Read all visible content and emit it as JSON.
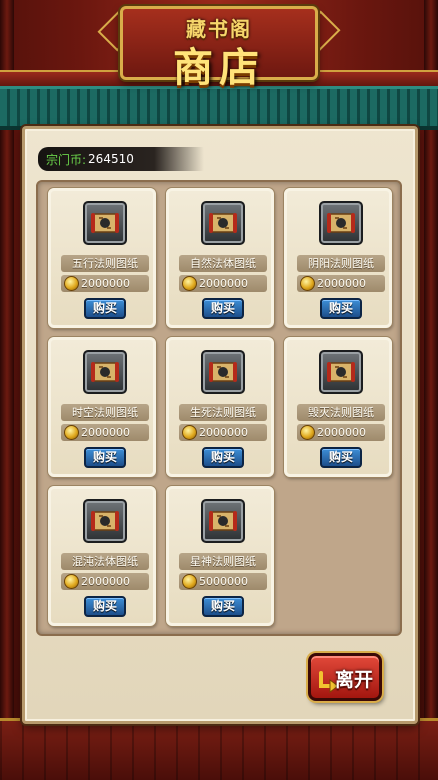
{
  "header": {
    "subtitle": "藏书阁",
    "title": "商店"
  },
  "currency": {
    "label": "宗门币:",
    "value": "264510"
  },
  "items": [
    {
      "name": "五行法则图纸",
      "price": "2000000",
      "buy_label": "购买",
      "icon": "scroll-icon"
    },
    {
      "name": "自然法体图纸",
      "price": "2000000",
      "buy_label": "购买",
      "icon": "scroll-icon"
    },
    {
      "name": "阴阳法则图纸",
      "price": "2000000",
      "buy_label": "购买",
      "icon": "scroll-icon"
    },
    {
      "name": "时空法则图纸",
      "price": "2000000",
      "buy_label": "购买",
      "icon": "scroll-icon"
    },
    {
      "name": "生死法则图纸",
      "price": "2000000",
      "buy_label": "购买",
      "icon": "scroll-icon"
    },
    {
      "name": "毁灭法则图纸",
      "price": "2000000",
      "buy_label": "购买",
      "icon": "scroll-icon"
    },
    {
      "name": "混沌法体图纸",
      "price": "2000000",
      "buy_label": "购买",
      "icon": "scroll-icon"
    },
    {
      "name": "星神法则图纸",
      "price": "5000000",
      "buy_label": "购买",
      "icon": "scroll-icon"
    }
  ],
  "leave_button": {
    "label": "离开"
  },
  "colors": {
    "currency_label": "#6ad14a",
    "buy_button": "#2a6cb3",
    "leave_button": "#c42a1c",
    "roof_tiles": "#1c6a62"
  }
}
